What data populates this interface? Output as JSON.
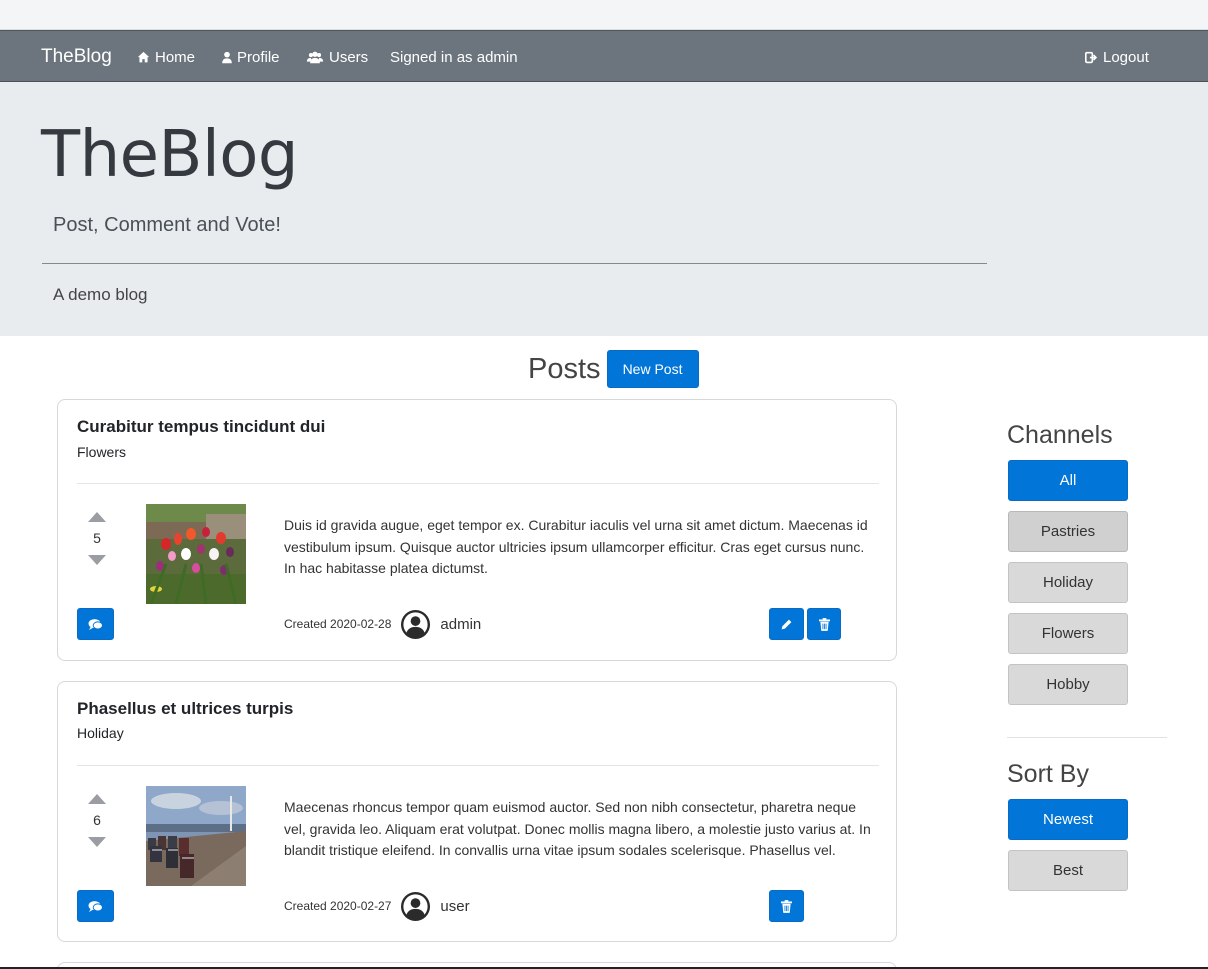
{
  "nav": {
    "brand": "TheBlog",
    "home": "Home",
    "profile": "Profile",
    "users": "Users",
    "signed_in": "Signed in as admin",
    "logout": "Logout"
  },
  "jumbotron": {
    "title": "TheBlog",
    "lead": "Post, Comment and Vote!",
    "description": "A demo blog"
  },
  "posts_header": {
    "title": "Posts",
    "new_post": "New Post"
  },
  "posts": [
    {
      "title": "Curabitur tempus tincidunt dui",
      "channel": "Flowers",
      "votes": "5",
      "text": "Duis id gravida augue, eget tempor ex. Curabitur iaculis vel urna sit amet dictum. Maecenas id vestibulum ipsum. Quisque auctor ultricies ipsum ullamcorper efficitur. Cras eget cursus nunc. In hac habitasse platea dictumst.",
      "created": "Created 2020-02-28",
      "author": "admin",
      "image": "tulips-photo"
    },
    {
      "title": "Phasellus et ultrices turpis",
      "channel": "Holiday",
      "votes": "6",
      "text": "Maecenas rhoncus tempor quam euismod auctor. Sed non nibh consectetur, pharetra neque vel, gravida leo. Aliquam erat volutpat. Donec mollis magna libero, a molestie justo varius at. In blandit tristique eleifend. In convallis urna vitae ipsum sodales scelerisque. Phasellus vel.",
      "created": "Created 2020-02-27",
      "author": "user",
      "image": "beach-chairs-photo"
    }
  ],
  "sidebar": {
    "channels_title": "Channels",
    "channels": [
      "All",
      "Pastries",
      "Holiday",
      "Flowers",
      "Hobby"
    ],
    "sort_title": "Sort By",
    "sort": [
      "Newest",
      "Best"
    ]
  },
  "colors": {
    "primary": "#0275d8",
    "navbar": "#6c757d",
    "jumbotron": "#e9ecef"
  }
}
